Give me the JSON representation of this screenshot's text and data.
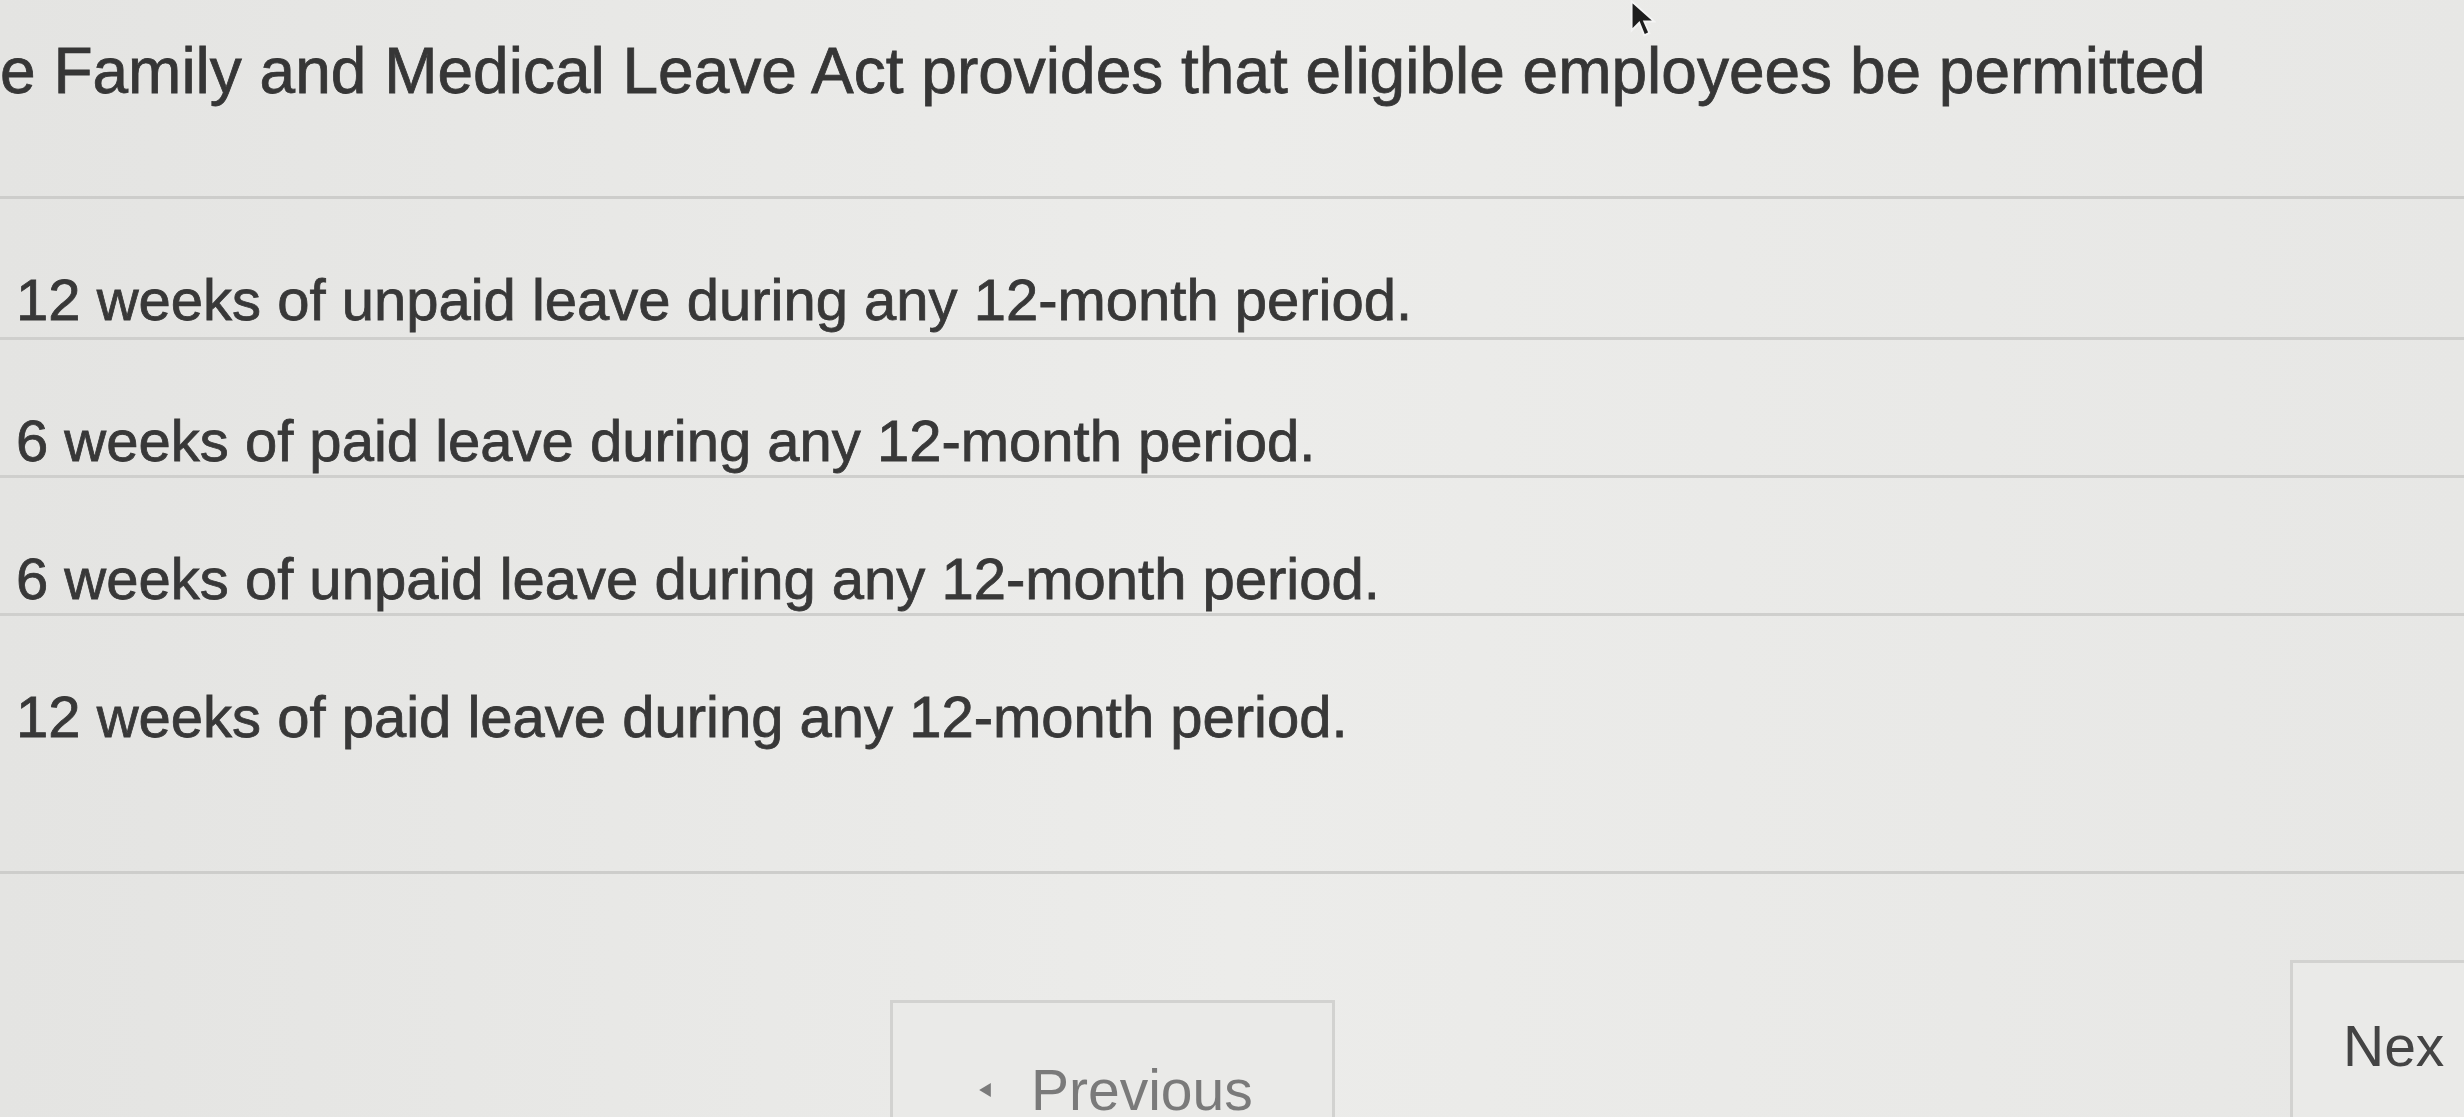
{
  "question": {
    "text": "e Family and Medical Leave Act provides that eligible employees be permitted"
  },
  "options": [
    {
      "label": "12 weeks of unpaid leave during any 12-month period.",
      "selected": false
    },
    {
      "label": "6 weeks of paid leave during any 12-month period.",
      "selected": false
    },
    {
      "label": "6 weeks of unpaid leave during any 12-month period.",
      "selected": false
    },
    {
      "label": "12 weeks of paid leave during any 12-month period.",
      "selected": false
    }
  ],
  "navigation": {
    "previous": {
      "label": "Previous",
      "disabled": true
    },
    "next": {
      "label": "Nex",
      "disabled": false
    }
  }
}
